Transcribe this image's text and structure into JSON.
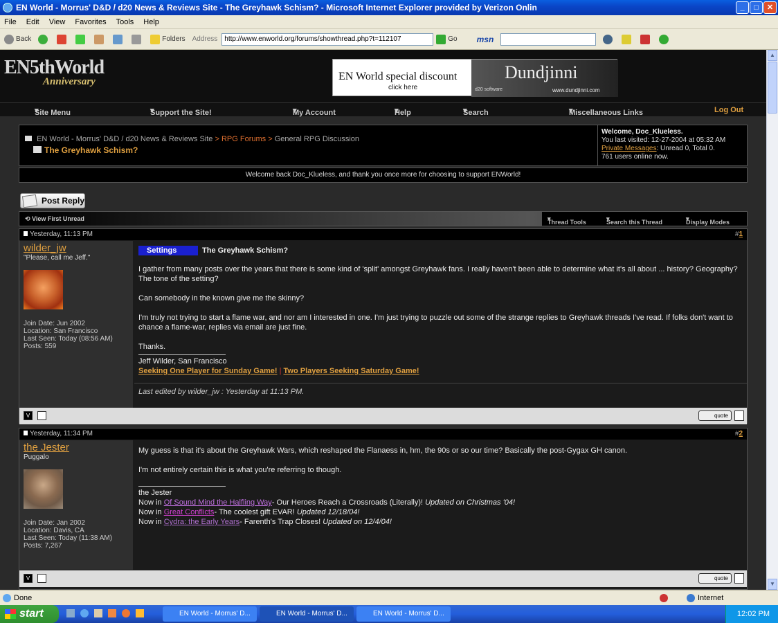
{
  "window": {
    "title": "EN World - Morrus' D&D / d20 News & Reviews Site - The Greyhawk Schism? - Microsoft Internet Explorer provided by Verizon Onlin"
  },
  "menubar": {
    "items": [
      "File",
      "Edit",
      "View",
      "Favorites",
      "Tools",
      "Help"
    ]
  },
  "toolbar": {
    "back": "Back",
    "folders": "Folders",
    "address_label": "Address",
    "url": "http://www.enworld.org/forums/showthread.php?t=112107",
    "go": "Go",
    "msn": "msn"
  },
  "site": {
    "logo_main": "EN5thWorld",
    "logo_sub": "Anniversary",
    "banner": {
      "left_text": "EN World special discount",
      "click": "click here",
      "brand": "Dundjinni",
      "url": "www.dundjinni.com",
      "small": "d20 software"
    },
    "nav": [
      "Site Menu",
      "Support the Site!",
      "My Account",
      "Help",
      "Search",
      "Miscellaneous Links",
      "Log Out"
    ]
  },
  "breadcrumb": {
    "home": "EN World - Morrus' D&D / d20 News & Reviews Site",
    "forums": "RPG Forums",
    "section": "General RPG Discussion",
    "sep": ">",
    "thread_title": "The Greyhawk Schism?"
  },
  "welcome": {
    "greeting": "Welcome, Doc_Klueless.",
    "last_visit": "You last visited: 12-27-2004 at 05:32 AM",
    "pm_label": "Private Messages",
    "pm_counts": ": Unread 0, Total 0.",
    "online": "761 users online now."
  },
  "thanks": "Welcome back Doc_Klueless, and thank you once more for choosing to support ENWorld!",
  "post_reply": "Post Reply",
  "threadbar": {
    "view_first_unread": "View First Unread",
    "thread_tools": "Thread Tools",
    "search_thread": "Search this Thread",
    "display_modes": "Display Modes"
  },
  "posts": [
    {
      "date": "Yesterday, 11:13 PM",
      "num_prefix": "#",
      "num": "1",
      "username": "wilder_jw",
      "user_title": "\"Please, call me Jeff.\"",
      "join_date": "Join Date: Jun 2002",
      "location": "Location: San Francisco",
      "last_seen": "Last Seen: Today (08:56 AM)",
      "posts": "Posts: 559",
      "settings_label": "Settings",
      "title": "The Greyhawk Schism?",
      "paragraphs": [
        "I gather from many posts over the years that there is some kind of 'split' amongst Greyhawk fans. I really haven't been able to determine what it's all about ... history? Geography? The tone of the setting?",
        "Can somebody in the known give me the skinny?",
        "I'm truly not trying to start a flame war, and nor am I interested in one. I'm just trying to puzzle out some of the strange replies to Greyhawk threads I've read. If folks don't want to chance a flame-war, replies via email are just fine.",
        "Thanks."
      ],
      "sig_name": "Jeff Wilder, San Francisco",
      "sig_link1": "Seeking One Player for Sunday Game!",
      "sig_sep": "|",
      "sig_link2": "Two Players Seeking Saturday Game!",
      "edited": "Last edited by wilder_jw : Yesterday at 11:13 PM.",
      "quote": "quote"
    },
    {
      "date": "Yesterday, 11:34 PM",
      "num_prefix": "#",
      "num": "2",
      "username": "the Jester",
      "user_title": "Puggalo",
      "join_date": "Join Date: Jan 2002",
      "location": "Location: Davis, CA",
      "last_seen": "Last Seen: Today (11:38 AM)",
      "posts": "Posts: 7,267",
      "paragraphs": [
        "My guess is that it's about the Greyhawk Wars, which reshaped the Flanaess in, hm, the 90s or so our time? Basically the post-Gygax GH canon.",
        "I'm not entirely certain this is what you're referring to though."
      ],
      "sig_name": "the Jester",
      "sig_lines": [
        {
          "pre": "Now in ",
          "link": "Of Sound Mind the Halfling Way",
          "post": "- Our Heroes Reach a Crossroads (Literally)! ",
          "em": "Updated on Christmas '04!"
        },
        {
          "pre": "Now in ",
          "link": "Great Conflicts",
          "post": "- The coolest gift EVAR! ",
          "em": "Updated 12/18/04!"
        },
        {
          "pre": "Now in ",
          "link": "Cydra: the Early Years",
          "post": "- Farenth's Trap Closes! ",
          "em": "Updated on 12/4/04!"
        }
      ],
      "quote": "quote"
    }
  ],
  "statusbar": {
    "done": "Done",
    "zone": "Internet"
  },
  "taskbar": {
    "start": "start",
    "tasks": [
      "EN World - Morrus' D...",
      "EN World - Morrus' D...",
      "EN World - Morrus' D..."
    ],
    "clock": "12:02 PM"
  },
  "colors": {
    "accent": "#e0a040",
    "link_pink": "#d040d0",
    "page_bg": "#2a2a2a"
  }
}
